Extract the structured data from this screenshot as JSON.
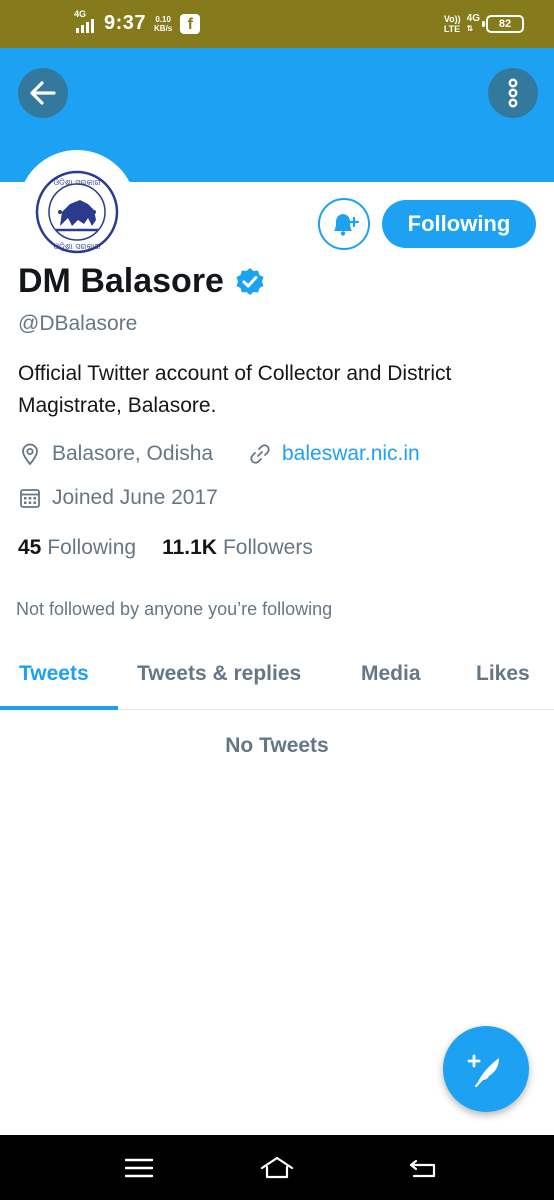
{
  "status_bar": {
    "time": "9:37",
    "network_left": "4G",
    "speed_value": "0.10",
    "speed_unit": "KB/s",
    "volte": "Vo))",
    "lte": "LTE",
    "network_right": "4G",
    "battery": "82",
    "notification_icon": "facebook-icon",
    "bg_color": "#857b1c"
  },
  "header": {
    "back_icon": "arrow-left-icon",
    "menu_icon": "more-vertical-icon",
    "banner_color": "#1da1f2"
  },
  "profile": {
    "name": "DM Balasore",
    "handle": "@DBalasore",
    "bio": "Official Twitter account of Collector and District Magistrate, Balasore.",
    "location": "Balasore, Odisha",
    "website": "baleswar.nic.in",
    "joined": "Joined June 2017",
    "following_count": "45",
    "following_label": "Following",
    "followers_count": "11.1K",
    "followers_label": "Followers",
    "not_followed_text": "Not followed by anyone you’re following",
    "follow_button_label": "Following",
    "avatar_text_top": "ଓଡ଼ିଶା ସରକାର",
    "avatar_text_bottom": "ଓଡ଼ିଶା ସରକାର"
  },
  "tabs": [
    {
      "label": "Tweets",
      "active": true
    },
    {
      "label": "Tweets & replies",
      "active": false
    },
    {
      "label": "Media",
      "active": false
    },
    {
      "label": "Likes",
      "active": false
    }
  ],
  "content": {
    "empty_text": "No Tweets"
  },
  "colors": {
    "accent": "#1da1f2",
    "text_secondary": "#657786",
    "text_primary": "#14171a"
  }
}
